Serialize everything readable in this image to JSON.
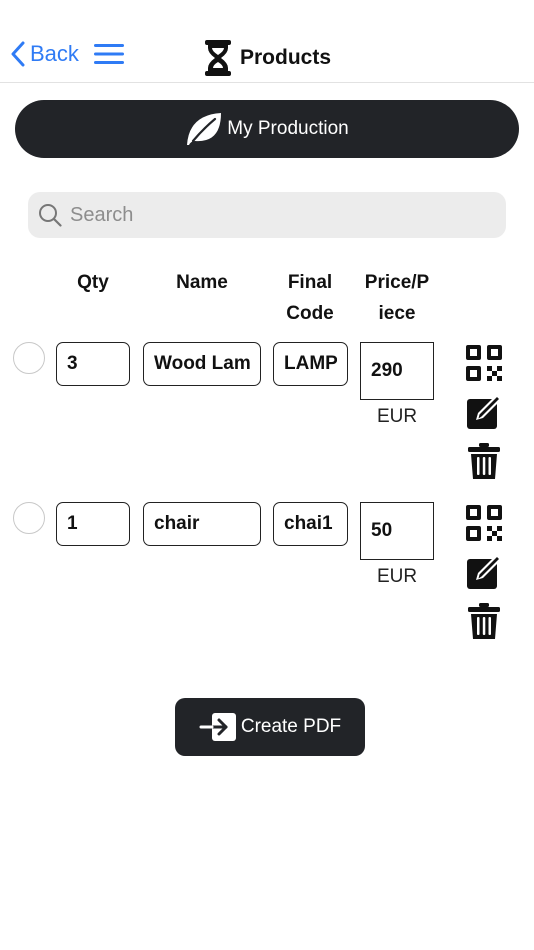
{
  "header": {
    "back_label": "Back",
    "title": "Products",
    "title_icon": "hourglass-icon",
    "menu_icon": "hamburger-menu-icon"
  },
  "production_button": {
    "label": "My Production",
    "icon": "leaf-icon"
  },
  "search": {
    "placeholder": "Search",
    "value": ""
  },
  "columns": {
    "qty": "Qty",
    "name": "Name",
    "final_code_1": "Final",
    "final_code_2": "Code",
    "price_1": "Price/P",
    "price_2": "iece"
  },
  "rows": [
    {
      "qty": "3",
      "name": "Wood Lamp",
      "code": "LAMP",
      "price": "290",
      "currency": "EUR"
    },
    {
      "qty": "1",
      "name": "chair",
      "code": "chai1",
      "price": "50",
      "currency": "EUR"
    }
  ],
  "pdf_button": {
    "label": "Create PDF",
    "icon": "export-arrow-icon"
  },
  "colors": {
    "accent": "#2f7bf5",
    "dark_button": "#222428"
  }
}
